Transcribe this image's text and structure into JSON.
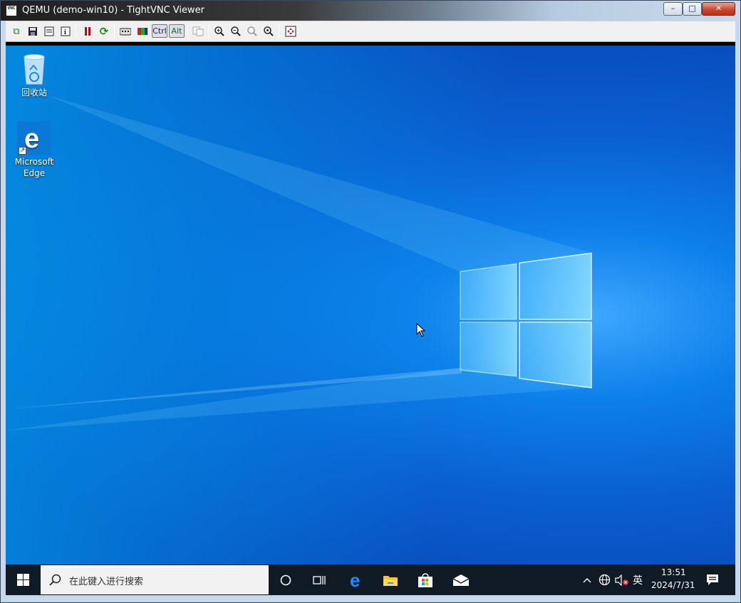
{
  "window": {
    "title": "QEMU (demo-win10) - TightVNC Viewer",
    "app_icon_label": "VNC",
    "controls": {
      "minimize": "–",
      "maximize": "□",
      "close": "✕"
    }
  },
  "toolbar": {
    "items": [
      {
        "name": "new-connection-icon",
        "glyph": "⧉"
      },
      {
        "name": "save-icon",
        "glyph": "💾"
      },
      {
        "name": "options-icon",
        "glyph": "▤"
      },
      {
        "name": "info-icon",
        "glyph": "ℹ"
      },
      {
        "name": "pause-icon",
        "glyph": "❚❚"
      },
      {
        "name": "refresh-icon",
        "glyph": "⟳"
      },
      {
        "name": "send-keys-icon",
        "glyph": "⌨"
      },
      {
        "name": "send-ctrl-alt-del-icon",
        "glyph": "▦"
      },
      {
        "name": "transfer-files-icon",
        "glyph": "⎘"
      },
      {
        "name": "zoom-in-icon",
        "glyph": "🔍"
      },
      {
        "name": "zoom-out-icon",
        "glyph": "🔍"
      },
      {
        "name": "zoom-100-icon",
        "glyph": "🔍"
      },
      {
        "name": "zoom-auto-icon",
        "glyph": "🔍"
      },
      {
        "name": "fullscreen-icon",
        "glyph": "⛶"
      }
    ],
    "ctrl_label": "Ctrl",
    "alt_label": "Alt"
  },
  "desktop": {
    "icons": [
      {
        "label": "回收站"
      },
      {
        "label_line1": "Microsoft",
        "label_line2": "Edge"
      }
    ]
  },
  "taskbar": {
    "search_placeholder": "在此键入进行搜索",
    "tray": {
      "ime": "英",
      "time": "13:51",
      "date": "2024/7/31"
    }
  },
  "colors": {
    "desktop_accent": "#0a78e6",
    "taskbar": "#0f1a24"
  }
}
